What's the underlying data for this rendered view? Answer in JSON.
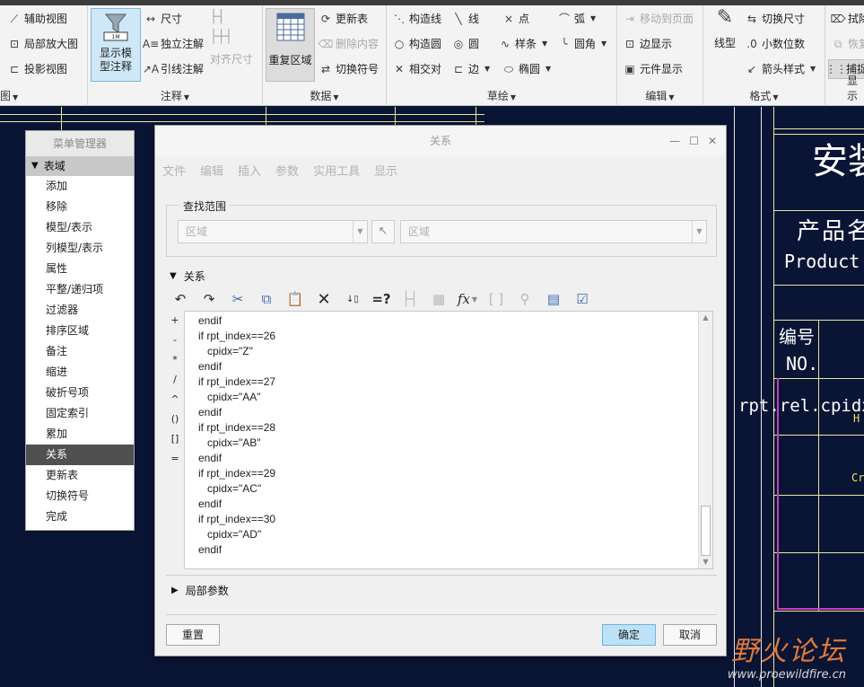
{
  "ribbon": {
    "groups": [
      {
        "title": "图",
        "items": [
          "辅助视图",
          "局部放大图",
          "投影视图"
        ]
      },
      {
        "title": "注释",
        "big": "显示模型注释",
        "items": [
          "尺寸",
          "独立注解",
          "引线注解"
        ],
        "dim_item": "对齐尺寸"
      },
      {
        "title": "数据",
        "big": "重复区域",
        "items": [
          "更新表",
          "删除内容",
          "切换符号"
        ]
      },
      {
        "title": "草绘",
        "items": [
          "构造线",
          "线",
          "点",
          "弧",
          "构造圆",
          "圆",
          "样条",
          "圆角",
          "相交对",
          "边",
          "椭圆"
        ]
      },
      {
        "title": "编辑",
        "items": [
          "移动到页面",
          "边显示",
          "元件显示"
        ]
      },
      {
        "title": "格式",
        "big": "线型",
        "items": [
          "切换尺寸",
          "小数位数",
          "箭头样式"
        ]
      },
      {
        "title": "显示",
        "items": [
          "拭除",
          "恢复",
          "捕捉"
        ]
      }
    ]
  },
  "canvas": {
    "title_big": "安装",
    "product_name_cn": "产品名",
    "product_name_en": "Product n",
    "number_cn": "编号",
    "number_en": "NO.",
    "rel_text": "rpt.rel.cpidx",
    "side_h": "H",
    "side_c": "Cr"
  },
  "menu_manager": {
    "title": "菜单管理器",
    "header": "表域",
    "items": [
      "添加",
      "移除",
      "模型/表示",
      "列模型/表示",
      "属性",
      "平整/递归项",
      "过滤器",
      "排序区域",
      "备注",
      "缩进",
      "破折号项",
      "固定索引",
      "累加",
      "关系",
      "更新表",
      "切换符号",
      "完成"
    ],
    "selected": "关系"
  },
  "dialog": {
    "title": "关系",
    "menu": [
      "文件",
      "编辑",
      "插入",
      "参数",
      "实用工具",
      "显示"
    ],
    "find_scope": {
      "legend": "查找范围",
      "combo1": "区域",
      "combo2": "区域"
    },
    "relations_section": "关系",
    "operators": [
      "+",
      "-",
      "*",
      "/",
      "^",
      "()",
      "[]",
      "="
    ],
    "code": "endif\nif rpt_index==26\n   cpidx=\"Z\"\nendif\nif rpt_index==27\n   cpidx=\"AA\"\nendif\nif rpt_index==28\n   cpidx=\"AB\"\nendif\nif rpt_index==29\n   cpidx=\"AC\"\nendif\nif rpt_index==30\n   cpidx=\"AD\"\nendif",
    "local_params": "局部参数",
    "reset": "重置",
    "ok": "确定",
    "cancel": "取消"
  },
  "watermark": {
    "cn": "野火论坛",
    "url": "www.proewildfire.cn"
  }
}
